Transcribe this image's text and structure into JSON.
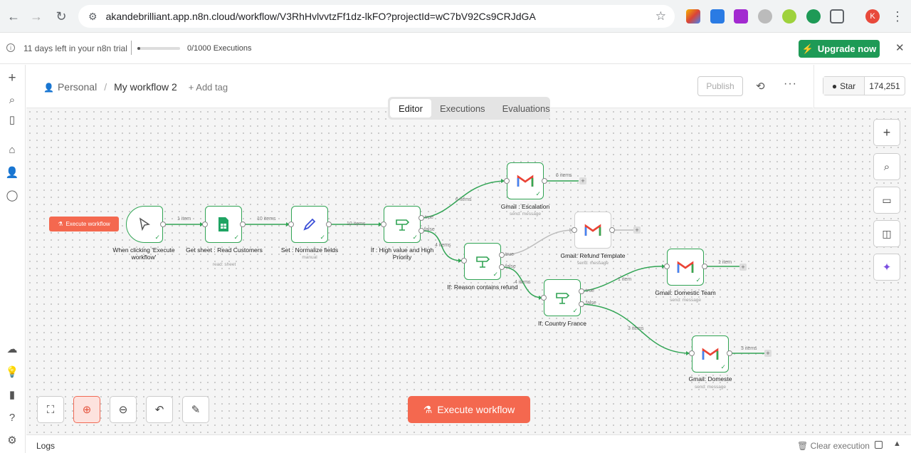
{
  "browser": {
    "url": "akandebrilliant.app.n8n.cloud/workflow/V3RhHvlvvtzFf1dz-lkFO?projectId=wC7bV92Cs9CRJdGA",
    "avatar": "K"
  },
  "trial": {
    "text": "11 days left in your n8n trial",
    "executions": "0/1000 Executions",
    "progress": 0.0,
    "upgrade_label": "Upgrade now"
  },
  "header": {
    "project": "Personal",
    "workflow_name": "My workflow 2",
    "add_tag": "+ Add tag",
    "publish_label": "Publish",
    "github_star": "Star",
    "github_count": "174,251"
  },
  "tabs": [
    "Editor",
    "Executions",
    "Evaluations"
  ],
  "canvas": {
    "execute_small": "Execute workflow",
    "execute_big": "Execute workflow",
    "nodes": [
      {
        "id": "trigger",
        "label": "When clicking 'Execute workflow'",
        "sub": ""
      },
      {
        "id": "sheet",
        "label": "Get sheet : Read Customers",
        "sub": "read: sheet"
      },
      {
        "id": "set",
        "label": "Set : Normalize fields",
        "sub": "manual"
      },
      {
        "id": "if1",
        "label": "If : High value and High Priority",
        "sub": ""
      },
      {
        "id": "gm_esc",
        "label": "Gmail : Escalation",
        "sub": "send: message"
      },
      {
        "id": "if2",
        "label": "If: Reason contains refund",
        "sub": ""
      },
      {
        "id": "gm_ref",
        "label": "Gmail: Refund Template",
        "sub": "send: message"
      },
      {
        "id": "if3",
        "label": "If: Country France",
        "sub": ""
      },
      {
        "id": "gm_dom",
        "label": "Gmail: Domestic Team",
        "sub": "send: message"
      },
      {
        "id": "gm_dom2",
        "label": "Gmail: Domeste",
        "sub": "send: message"
      }
    ],
    "edges": {
      "e1": "1 item",
      "e2": "10 items",
      "e3": "10 items",
      "e4": "6 items",
      "e5": "4 items",
      "e6": "6 items",
      "e7": "4 items",
      "e8": "1 item",
      "e9": "1 item",
      "e10": "3 items",
      "e11": "3 items",
      "true": "true",
      "false": "false"
    }
  },
  "logs": {
    "title": "Logs",
    "clear": "Clear execution"
  },
  "colors": {
    "accent": "#f4684f",
    "success": "#31a454",
    "upgrade": "#1e9a56"
  }
}
